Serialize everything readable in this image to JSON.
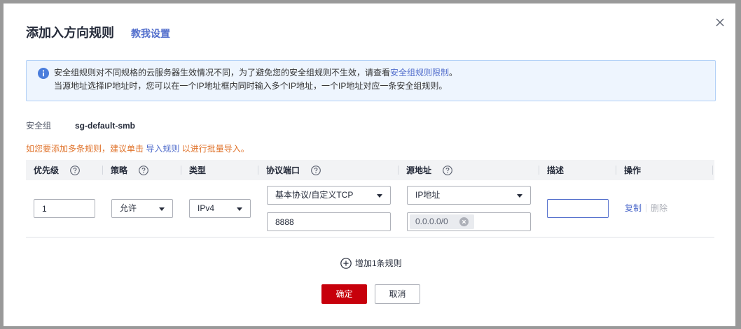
{
  "dialog": {
    "title": "添加入方向规则",
    "help_link": "教我设置",
    "close_icon": "close-icon"
  },
  "notice": {
    "icon": "info-icon",
    "line1_text": "安全组规则对不同规格的云服务器生效情况不同，为了避免您的安全组规则不生效，请查看",
    "line1_link": "安全组规则限制",
    "line1_end": "。",
    "line2_text": "当源地址选择IP地址时，您可以在一个IP地址框内同时输入多个IP地址，一个IP地址对应一条安全组规则。"
  },
  "security_group": {
    "label": "安全组",
    "value": "sg-default-smb"
  },
  "import_hint": {
    "text_before": "如您要添加多条规则，建议单击 ",
    "link": "导入规则",
    "text_after": " 以进行批量导入。"
  },
  "table": {
    "columns": [
      {
        "label": "优先级",
        "help_icon": "question-circle-icon"
      },
      {
        "label": "策略",
        "help_icon": "question-circle-icon"
      },
      {
        "label": "类型"
      },
      {
        "label": "协议端口",
        "help_icon": "question-circle-icon"
      },
      {
        "label": "源地址",
        "help_icon": "question-circle-icon"
      },
      {
        "label": "描述"
      },
      {
        "label": "操作"
      }
    ],
    "rows": [
      {
        "priority": "1",
        "policy": "允许",
        "type": "IPv4",
        "protocol": "基本协议/自定义TCP",
        "port": "8888",
        "source_type": "IP地址",
        "source_tags": [
          "0.0.0.0/0"
        ],
        "description": "",
        "actions": {
          "copy": "复制",
          "delete": "删除"
        }
      }
    ]
  },
  "add_rule": {
    "icon": "plus-circle-icon",
    "label": "增加1条规则"
  },
  "footer": {
    "confirm": "确定",
    "cancel": "取消"
  },
  "colors": {
    "primary_link": "#526ecc",
    "confirm_button": "#c7000b",
    "warning_text": "#e0742d",
    "notice_background": "#eef5fe",
    "notice_icon": "#4a7ddc"
  }
}
